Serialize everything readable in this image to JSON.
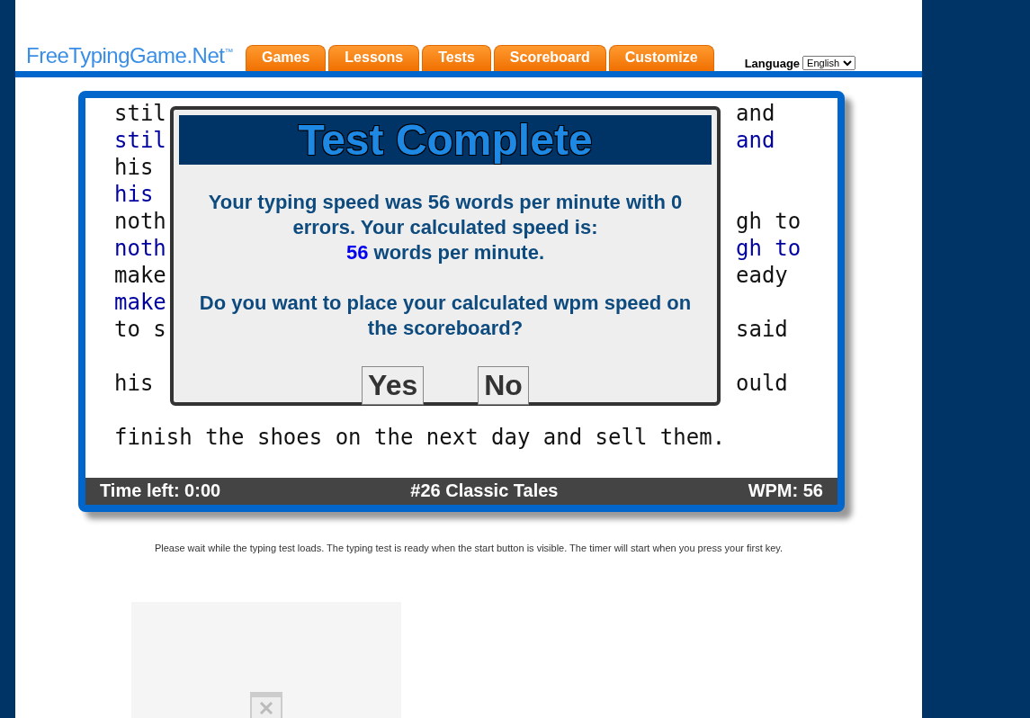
{
  "header": {
    "logo": "FreeTypingGame.Net",
    "trademark": "™",
    "tabs": [
      {
        "label": "Games"
      },
      {
        "label": "Lessons"
      },
      {
        "label": "Tests"
      },
      {
        "label": "Scoreboard"
      },
      {
        "label": "Customize"
      }
    ],
    "language": {
      "label": "Language",
      "value": "English"
    }
  },
  "typing_box": {
    "passage": [
      {
        "kind": "source",
        "left": "stil",
        "right": "and"
      },
      {
        "kind": "typed",
        "left": "stil",
        "right": "and"
      },
      {
        "kind": "source",
        "left": "his"
      },
      {
        "kind": "typed",
        "left": "his"
      },
      {
        "kind": "source",
        "left": "noth",
        "right": "gh to"
      },
      {
        "kind": "typed",
        "left": "noth",
        "right": "gh to"
      },
      {
        "kind": "source",
        "left": "make",
        "right": "eady"
      },
      {
        "kind": "typed",
        "left": "make"
      },
      {
        "kind": "source",
        "left": "to s",
        "right": "said"
      },
      {
        "kind": "blank"
      },
      {
        "kind": "source",
        "left": "his",
        "right": "ould"
      },
      {
        "kind": "blank"
      },
      {
        "kind": "source",
        "left": "finish the shoes on the next day and sell them."
      },
      {
        "kind": "blank"
      }
    ],
    "status_bar": {
      "time_left": "Time left: 0:00",
      "title": "#26 Classic Tales",
      "wpm": "WPM: 56"
    }
  },
  "dialog": {
    "title": "Test Complete",
    "message": "Your typing speed was 56 words per minute with 0 errors. Your calculated speed is:",
    "speed_value": "56",
    "speed_unit": "words per minute.",
    "question": "Do you want to place your calculated wpm speed on the scoreboard?",
    "buttons": [
      "Yes",
      "No"
    ]
  },
  "notice": "Please wait while the typing test loads. The typing test is ready when the start button is visible. The timer will start when you press your first key."
}
